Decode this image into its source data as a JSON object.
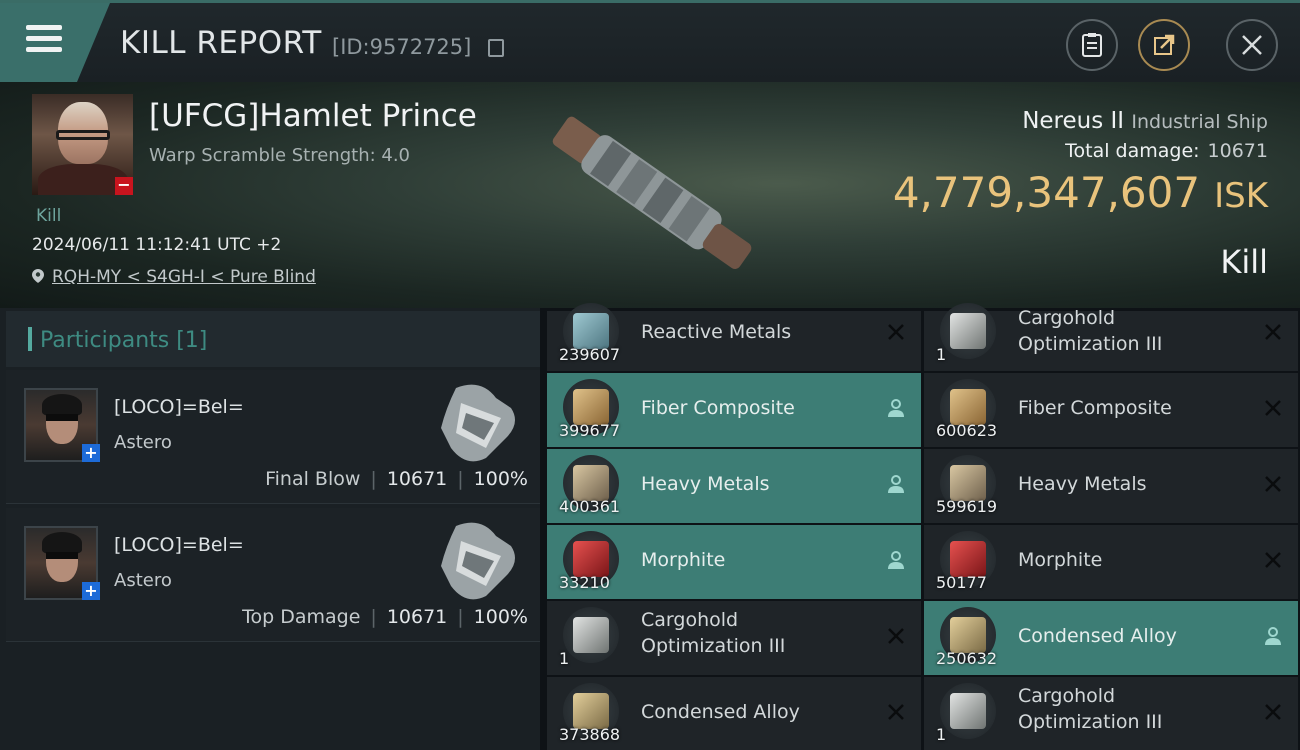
{
  "header": {
    "title": "KILL REPORT",
    "kill_id": "[ID:9572725]",
    "icons": [
      "menu-icon",
      "copy-icon",
      "clipboard-icon",
      "share-icon",
      "close-icon"
    ]
  },
  "victim": {
    "name": "[UFCG]Hamlet Prince",
    "warp_scramble": "Warp Scramble Strength: 4.0",
    "tag": "Kill",
    "datetime": "2024/06/11 11:12:41 UTC +2",
    "location": "RQH-MY < S4GH-I < Pure Blind",
    "ship_name": "Nereus II",
    "ship_class": "Industrial Ship",
    "total_damage_label": "Total damage:",
    "total_damage": "10671",
    "isk_value": "4,779,347,607",
    "isk_unit": "ISK",
    "result": "Kill"
  },
  "participants": {
    "header": "Participants [1]",
    "rows": [
      {
        "name": "[LOCO]=Bel=",
        "ship": "Astero",
        "role": "Final Blow",
        "damage": "10671",
        "percent": "100%"
      },
      {
        "name": "[LOCO]=Bel=",
        "ship": "Astero",
        "role": "Top Damage",
        "damage": "10671",
        "percent": "100%"
      }
    ]
  },
  "items": {
    "col1": [
      {
        "name": "Reactive Metals",
        "qty": "239607",
        "highlight": false,
        "action": "x"
      },
      {
        "name": "Fiber Composite",
        "qty": "399677",
        "highlight": true,
        "action": "person"
      },
      {
        "name": "Heavy Metals",
        "qty": "400361",
        "highlight": true,
        "action": "person"
      },
      {
        "name": "Morphite",
        "qty": "33210",
        "highlight": true,
        "action": "person"
      },
      {
        "name": "Cargohold Optimization III",
        "qty": "1",
        "highlight": false,
        "action": "x"
      },
      {
        "name": "Condensed Alloy",
        "qty": "373868",
        "highlight": false,
        "action": "x"
      }
    ],
    "col2": [
      {
        "name": "Cargohold Optimization III",
        "qty": "1",
        "highlight": false,
        "action": "x"
      },
      {
        "name": "Fiber Composite",
        "qty": "600623",
        "highlight": false,
        "action": "x"
      },
      {
        "name": "Heavy Metals",
        "qty": "599619",
        "highlight": false,
        "action": "x"
      },
      {
        "name": "Morphite",
        "qty": "50177",
        "highlight": false,
        "action": "x"
      },
      {
        "name": "Condensed Alloy",
        "qty": "250632",
        "highlight": true,
        "action": "person"
      },
      {
        "name": "Cargohold Optimization III",
        "qty": "1",
        "highlight": false,
        "action": "x"
      }
    ]
  },
  "colors": {
    "accent": "#3d7d75",
    "isk": "#e9c37c",
    "danger_badge": "#c8141e",
    "plus_badge": "#1d6bd8"
  }
}
